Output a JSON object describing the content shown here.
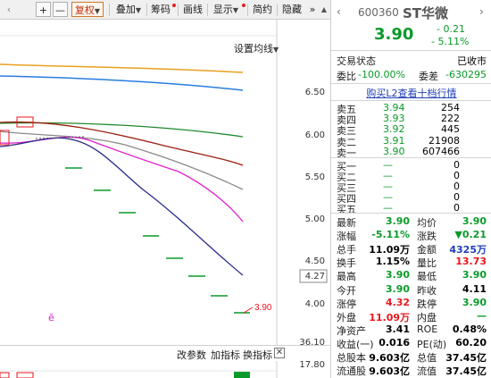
{
  "toolbar": {
    "fuquan": "复权",
    "diejia": "叠加",
    "chouma": "筹码",
    "huaxian": "画线",
    "xianshi": "显示",
    "jianyue": "简约",
    "yincang": "隐藏",
    "nav_right": "»",
    "minus": "—",
    "plus": "+",
    "fold": "▲"
  },
  "chart": {
    "setting_label": "设置均线",
    "y_ticks": [
      "6.50",
      "6.00",
      "5.50",
      "5.00",
      "4.50",
      "4.00"
    ],
    "price_axis_box": "4.27",
    "price_callout": "3.90",
    "marker": "ē",
    "sub_y_ticks": [
      "36.10",
      "17.80"
    ],
    "sub_bar": {
      "gaicanshu": "改参数",
      "jiazhibiao": "加指标",
      "huanzhibiao": "换指标",
      "close": "✕"
    }
  },
  "chart_data": {
    "type": "line",
    "ylim": [
      3.85,
      6.7
    ],
    "note": "K-line candlestick panel with moving averages; values estimated from pixels",
    "series": [
      {
        "name": "ma_orange",
        "values": [
          6.72,
          6.7,
          6.68,
          6.66,
          6.64,
          6.62
        ]
      },
      {
        "name": "ma_blue",
        "values": [
          6.58,
          6.57,
          6.56,
          6.55,
          6.53,
          6.5
        ]
      },
      {
        "name": "ma_green",
        "values": [
          6.1,
          6.09,
          6.08,
          6.06,
          6.03,
          6.0
        ]
      },
      {
        "name": "ma_darkred",
        "values": [
          6.08,
          6.05,
          5.95,
          5.8,
          5.65,
          5.5
        ]
      },
      {
        "name": "ma_gray",
        "values": [
          6.0,
          6.03,
          5.92,
          5.75,
          5.55,
          5.38
        ]
      },
      {
        "name": "ma_magenta",
        "values": [
          5.95,
          6.0,
          5.85,
          5.5,
          5.18,
          5.01
        ]
      },
      {
        "name": "ma_navy",
        "values": [
          5.9,
          5.98,
          5.9,
          5.4,
          4.8,
          4.38
        ]
      }
    ]
  },
  "quote": {
    "code": "600360",
    "name": "ST华微",
    "price": "3.90",
    "change": "- 0.21",
    "change_pct": "- 5.11%",
    "trade_status_label": "交易状态",
    "trade_status": "已收市",
    "weibi_label": "委比",
    "weibi": "-100.00%",
    "weicha_label": "委差",
    "weicha": "-630295",
    "l2_link": "购买L2查看十档行情"
  },
  "sell": [
    {
      "label": "卖五",
      "price": "3.94",
      "vol": "254"
    },
    {
      "label": "卖四",
      "price": "3.93",
      "vol": "222"
    },
    {
      "label": "卖三",
      "price": "3.92",
      "vol": "445"
    },
    {
      "label": "卖二",
      "price": "3.91",
      "vol": "21908"
    },
    {
      "label": "卖一",
      "price": "3.90",
      "vol": "607466"
    }
  ],
  "buy": [
    {
      "label": "买一",
      "price": "—",
      "vol": "0"
    },
    {
      "label": "买二",
      "price": "—",
      "vol": "0"
    },
    {
      "label": "买三",
      "price": "—",
      "vol": "0"
    },
    {
      "label": "买四",
      "price": "—",
      "vol": "0"
    },
    {
      "label": "买五",
      "price": "—",
      "vol": "0"
    }
  ],
  "stats": [
    {
      "l1": "最新",
      "v1": "3.90",
      "c1": "green",
      "l2": "均价",
      "v2": "3.90",
      "c2": "green"
    },
    {
      "l1": "涨幅",
      "v1": "-5.11%",
      "c1": "green",
      "l2": "涨跌",
      "v2": "▼0.21",
      "c2": "green"
    },
    {
      "l1": "总手",
      "v1": "11.09万",
      "c1": "black",
      "l2": "金额",
      "v2": "4325万",
      "c2": "blue"
    },
    {
      "l1": "换手",
      "v1": "1.15%",
      "c1": "black",
      "l2": "量比",
      "v2": "13.73",
      "c2": "red"
    },
    {
      "l1": "最高",
      "v1": "3.90",
      "c1": "green",
      "l2": "最低",
      "v2": "3.90",
      "c2": "green"
    },
    {
      "l1": "今开",
      "v1": "3.90",
      "c1": "green",
      "l2": "昨收",
      "v2": "4.11",
      "c2": "black"
    },
    {
      "l1": "涨停",
      "v1": "4.32",
      "c1": "red",
      "l2": "跌停",
      "v2": "3.90",
      "c2": "green"
    },
    {
      "l1": "外盘",
      "v1": "11.09万",
      "c1": "red",
      "l2": "内盘",
      "v2": "—",
      "c2": "green"
    },
    {
      "l1": "净资产",
      "v1": "3.41",
      "c1": "black",
      "l2": "ROE",
      "v2": "0.48%",
      "c2": "black"
    },
    {
      "l1": "收益(一)",
      "v1": "0.016",
      "c1": "black",
      "l2": "PE(动)",
      "v2": "60.20",
      "c2": "black"
    },
    {
      "l1": "总股本",
      "v1": "9.603亿",
      "c1": "black",
      "l2": "总值",
      "v2": "37.45亿",
      "c2": "black"
    },
    {
      "l1": "流通股",
      "v1": "9.603亿",
      "c1": "black",
      "l2": "流值",
      "v2": "37.45亿",
      "c2": "black"
    }
  ],
  "colors": {
    "up": "#e8161e",
    "down": "#0a9a2a",
    "link": "#1f3eb8"
  }
}
